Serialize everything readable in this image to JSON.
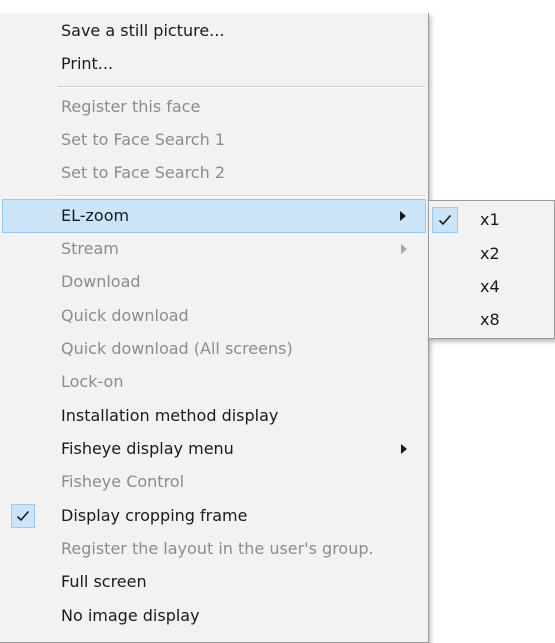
{
  "top_partial_text": "",
  "main_menu": {
    "items": [
      {
        "label": "Save a still picture...",
        "disabled": false
      },
      {
        "label": "Print...",
        "disabled": false
      },
      {
        "label": "Register this face",
        "disabled": true
      },
      {
        "label": "Set to Face Search 1",
        "disabled": true
      },
      {
        "label": "Set to Face Search 2",
        "disabled": true
      },
      {
        "label": "EL-zoom",
        "disabled": false,
        "highlighted": true,
        "submenu": true
      },
      {
        "label": "Stream",
        "disabled": true,
        "submenu": true
      },
      {
        "label": "Download",
        "disabled": true
      },
      {
        "label": "Quick download",
        "disabled": true
      },
      {
        "label": "Quick download (All screens)",
        "disabled": true
      },
      {
        "label": "Lock-on",
        "disabled": true
      },
      {
        "label": "Installation method display",
        "disabled": false
      },
      {
        "label": "Fisheye display menu",
        "disabled": false,
        "submenu": true
      },
      {
        "label": "Fisheye Control",
        "disabled": true
      },
      {
        "label": "Display cropping frame",
        "disabled": false,
        "checked": true
      },
      {
        "label": "Register the layout in the user's group.",
        "disabled": true
      },
      {
        "label": "Full screen",
        "disabled": false
      },
      {
        "label": "No image display",
        "disabled": false
      }
    ]
  },
  "zoom_submenu": {
    "items": [
      {
        "label": "x1",
        "checked": true
      },
      {
        "label": "x2",
        "checked": false
      },
      {
        "label": "x4",
        "checked": false
      },
      {
        "label": "x8",
        "checked": false
      }
    ]
  },
  "icons": {
    "check": "check-icon",
    "submenu_arrow": "chevron-right-icon"
  },
  "colors": {
    "menu_bg": "#f2f2f2",
    "highlight_bg": "#cce4f7",
    "highlight_border": "#99c9ef",
    "disabled_text": "#8c8c8c",
    "text": "#1a1a1a"
  }
}
